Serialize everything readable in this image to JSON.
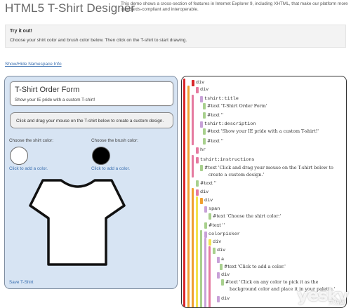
{
  "header": {
    "title": "HTML5 T-Shirt Designer",
    "description": "This demo shows a cross-section of features in Internet Explorer 9, including XHTML, that make our platform more standards-compliant and interoperable."
  },
  "tryout": {
    "title": "Try it out!",
    "text": "Choose your shirt color and brush color below. Then click on the T-shirt to start drawing."
  },
  "namespace_link": "Show/Hide Namespace Info",
  "form": {
    "title": "T-Shirt Order Form",
    "description": "Show your IE pride with a custom T-shirt!",
    "instructions": "Click and drag your mouse on the T-shirt below to create a custom design.",
    "shirt_color_label": "Choose the shirt color:",
    "shirt_color_link": "Click to add a color.",
    "brush_color_label": "Choose the brush color:",
    "brush_color_link": "Click to add a color.",
    "save_link": "Save T-Shirt",
    "shirt_color": "#ffffff",
    "brush_color": "#000000"
  },
  "tree": {
    "rows": [
      {
        "text": "div",
        "kind": "tag",
        "color": "#d9262b"
      },
      {
        "text": "div",
        "kind": "tag",
        "color": "#e57aa0"
      },
      {
        "text": "tshirt:title",
        "kind": "tag",
        "color": "#c8a2d8"
      },
      {
        "text": "#text 'T-Shirt Order Form'",
        "kind": "text",
        "color": "#a8d08d"
      },
      {
        "text": "#text ''",
        "kind": "text",
        "color": "#a8d08d"
      },
      {
        "text": "tshirt:description",
        "kind": "tag",
        "color": "#c8a2d8"
      },
      {
        "text": "#text 'Show your IE pride with a custom T-shirt!'",
        "kind": "text",
        "color": "#a8d08d"
      },
      {
        "text": "#text ''",
        "kind": "text",
        "color": "#a8d08d"
      },
      {
        "text": "hr",
        "kind": "tag",
        "color": "#e57aa0"
      },
      {
        "text": "tshirt:instructions",
        "kind": "tag",
        "color": "#e57aa0"
      },
      {
        "text": "#text 'Click and drag your mouse on the T-shirt below to",
        "kind": "text",
        "color": "#a8d08d"
      },
      {
        "text": "create a custom design.'",
        "kind": "text",
        "color": ""
      },
      {
        "text": "#text ''",
        "kind": "text",
        "color": "#a8d08d"
      },
      {
        "text": "div",
        "kind": "tag",
        "color": "#e57aa0"
      },
      {
        "text": "div",
        "kind": "tag",
        "color": "#f0a030"
      },
      {
        "text": "span",
        "kind": "tag",
        "color": "#c8a2d8"
      },
      {
        "text": "#text 'Choose the shirt color:'",
        "kind": "text",
        "color": "#a8d08d"
      },
      {
        "text": "#text ''",
        "kind": "text",
        "color": "#a8d08d"
      },
      {
        "text": "colorpicker",
        "kind": "tag",
        "color": "#c8a2d8"
      },
      {
        "text": "div",
        "kind": "tag",
        "color": "#f2e24e"
      },
      {
        "text": "div",
        "kind": "tag",
        "color": "#a8d08d"
      },
      {
        "text": "a",
        "kind": "tag",
        "color": "#c8a2d8"
      },
      {
        "text": "#text 'Click to add a color.'",
        "kind": "text",
        "color": "#a8d08d"
      },
      {
        "text": "div",
        "kind": "tag",
        "color": "#c8a2d8"
      },
      {
        "text": "#text 'Click on any color to pick it as the",
        "kind": "text",
        "color": "#a8d08d"
      },
      {
        "text": "background color and place it in your palette.'",
        "kind": "text",
        "color": ""
      },
      {
        "text": "div",
        "kind": "tag",
        "color": "#c8a2d8"
      }
    ]
  },
  "watermark": {
    "text": "yesky",
    "cn": "天极网"
  }
}
